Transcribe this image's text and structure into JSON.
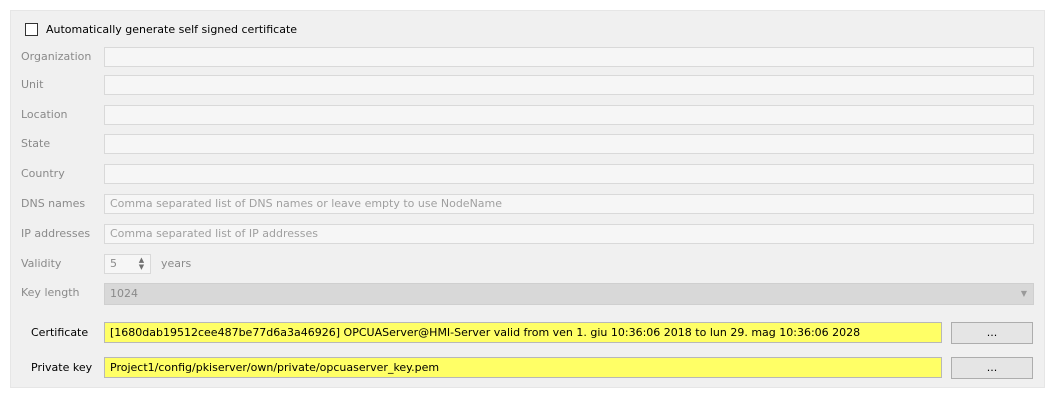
{
  "auto_generate": {
    "label": "Automatically generate self signed certificate",
    "checked": false
  },
  "fields": {
    "organization": {
      "label": "Organization",
      "value": ""
    },
    "unit": {
      "label": "Unit",
      "value": ""
    },
    "location": {
      "label": "Location",
      "value": ""
    },
    "state": {
      "label": "State",
      "value": ""
    },
    "country": {
      "label": "Country",
      "value": ""
    },
    "dns_names": {
      "label": "DNS names",
      "placeholder": "Comma separated list of DNS names or leave empty to use NodeName"
    },
    "ip_addresses": {
      "label": "IP addresses",
      "placeholder": "Comma separated list of IP addresses"
    }
  },
  "validity": {
    "label": "Validity",
    "value": "5",
    "unit": "years"
  },
  "key_length": {
    "label": "Key length",
    "value": "1024"
  },
  "certificate": {
    "label": "Certificate",
    "value": "[1680dab19512cee487be77d6a3a46926] OPCUAServer@HMI-Server   valid from ven 1. giu 10:36:06 2018 to lun 29. mag 10:36:06 2028",
    "browse_label": "..."
  },
  "private_key": {
    "label": "Private key",
    "value": "Project1/config/pkiserver/own/private/opcuaserver_key.pem",
    "browse_label": "..."
  }
}
